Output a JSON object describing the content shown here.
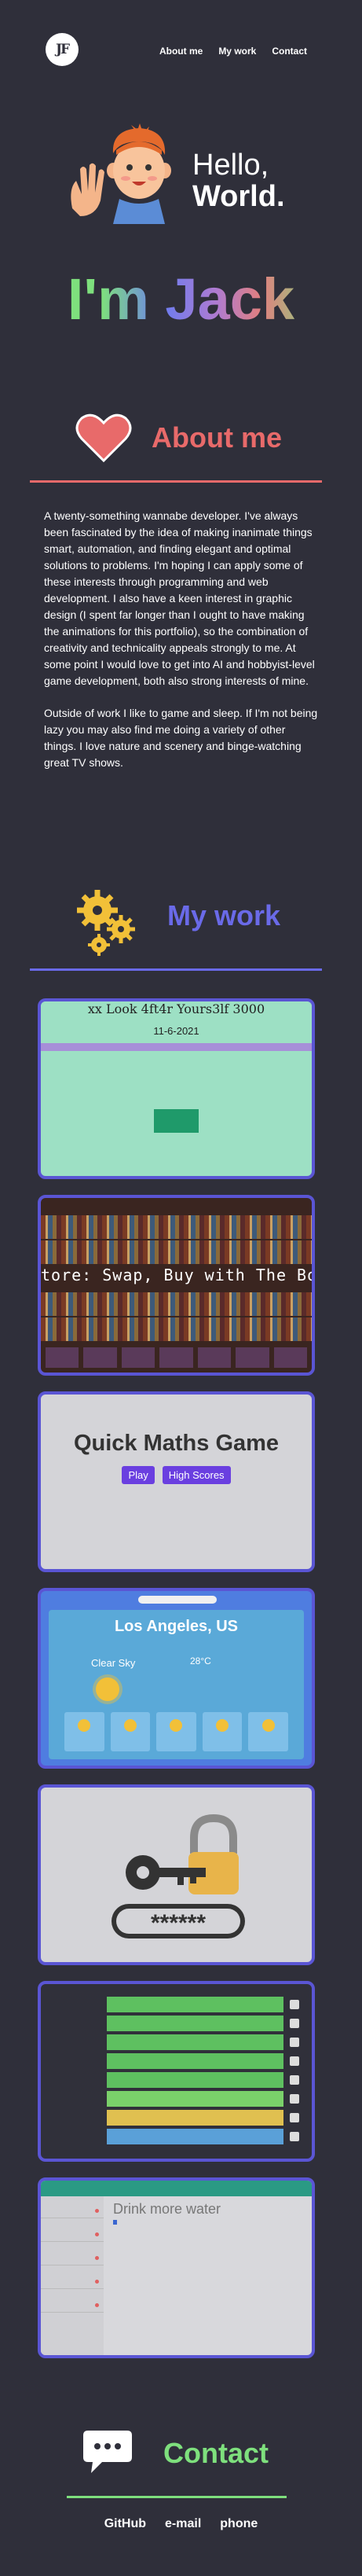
{
  "header": {
    "logo_text": "JF",
    "nav": [
      "About me",
      "My work",
      "Contact"
    ]
  },
  "hero": {
    "greeting_line1": "Hello,",
    "greeting_line2": "World.",
    "name": "I'm Jack"
  },
  "about": {
    "title": "About me",
    "paragraphs": [
      "A twenty-something wannabe developer. I've always been fascinated by the idea of making inanimate things smart, automation, and finding elegant and optimal solutions to problems. I'm hoping I can apply some of these interests through programming and web development. I also have a keen interest in graphic design (I spent far longer than I ought to have making the animations for this portfolio), so the combination of creativity and technicality appeals strongly to me. At some point I would love to get into AI and hobbyist-level game development, both also strong interests of mine.",
      "Outside of work I like to game and sleep. If I'm not being lazy you may also find me doing a variety of other things. I love nature and scenery and binge-watching great TV shows."
    ]
  },
  "work": {
    "title": "My work",
    "projects": {
      "calendar": {
        "title": "xx Look 4ft4r Yours3lf 3000",
        "date": "11-6-2021"
      },
      "bookstore": {
        "title": "tore: Swap, Buy with The BookAp"
      },
      "maths": {
        "title": "Quick Maths Game",
        "buttons": [
          "Play",
          "High Scores"
        ]
      },
      "weather": {
        "city": "Los Angeles, US",
        "condition": "Clear Sky",
        "temp": "28°C"
      },
      "password": {
        "mask": "******"
      },
      "schedule": {},
      "todo": {
        "title": "Drink more water"
      }
    }
  },
  "contact": {
    "title": "Contact",
    "links": [
      "GitHub",
      "e-mail",
      "phone"
    ]
  },
  "colors": {
    "background": "#2f2f3a",
    "about_accent": "#e86a6a",
    "work_accent": "#6a6ae8",
    "contact_accent": "#7ee07d"
  }
}
